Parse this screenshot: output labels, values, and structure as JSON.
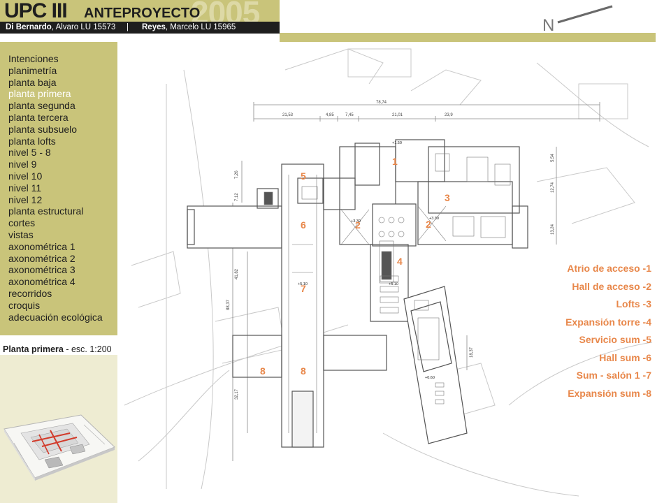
{
  "header": {
    "title_main": "UPC III",
    "title_sub": "ANTEPROYECTO",
    "title_year": "2005",
    "author1_name": "Di Bernardo",
    "author1_rest": ", Alvaro  LU 15573",
    "separator": "|",
    "author2_name": "Reyes",
    "author2_rest": ", Marcelo  LU 15965",
    "north_label": "N"
  },
  "menu": {
    "items": [
      {
        "label": "Intenciones"
      },
      {
        "label": "planimetría"
      },
      {
        "label": "planta baja"
      },
      {
        "label": "planta primera",
        "active": true
      },
      {
        "label": "planta segunda"
      },
      {
        "label": "planta tercera"
      },
      {
        "label": "planta subsuelo"
      },
      {
        "label": "planta lofts"
      },
      {
        "label": "nivel 5 - 8"
      },
      {
        "label": "nivel 9"
      },
      {
        "label": "nivel 10"
      },
      {
        "label": "nivel 11"
      },
      {
        "label": "nivel 12"
      },
      {
        "label": "planta estructural"
      },
      {
        "label": "cortes"
      },
      {
        "label": "vistas"
      },
      {
        "label": "axonométrica 1"
      },
      {
        "label": "axonométrica 2"
      },
      {
        "label": "axonométrica 3"
      },
      {
        "label": "axonométrica 4"
      },
      {
        "label": "recorridos"
      },
      {
        "label": "croquis"
      },
      {
        "label": "adecuación ecológica"
      }
    ]
  },
  "caption": {
    "bold": "Planta primera",
    "rest": " - esc. 1:200"
  },
  "plan": {
    "dimensions_top": [
      "78,74",
      "21,53",
      "4,85",
      "7,45",
      "21,01",
      "23,9"
    ],
    "dimensions_left": [
      "7,26",
      "7,12",
      "41,82",
      "88,37",
      "32,17"
    ],
    "dimensions_right": [
      "5,54",
      "12,74",
      "13,24"
    ],
    "dimension_extra": "18,37",
    "levels": [
      "+1.50",
      "+3.30",
      "+3.30",
      "+5.10",
      "+5.10",
      "+0.60"
    ],
    "space_numbers": [
      "1",
      "2",
      "2",
      "3",
      "4",
      "5",
      "6",
      "7",
      "8",
      "8"
    ]
  },
  "legend": {
    "items": [
      "Atrio de acceso -1",
      "Hall de acceso -2",
      "Lofts -3",
      "Expansión torre -4",
      "Servicio sum -5",
      "Hall sum -6",
      "Sum - salón 1 -7",
      "Expansión sum -8"
    ]
  },
  "colors": {
    "olive": "#c9c47a",
    "olive_light": "#ddd9a6",
    "accent_orange": "#e8874a",
    "dark": "#1e1e1e",
    "line_gray": "#9a9a9a",
    "active_menu_text": "#ffffff"
  }
}
